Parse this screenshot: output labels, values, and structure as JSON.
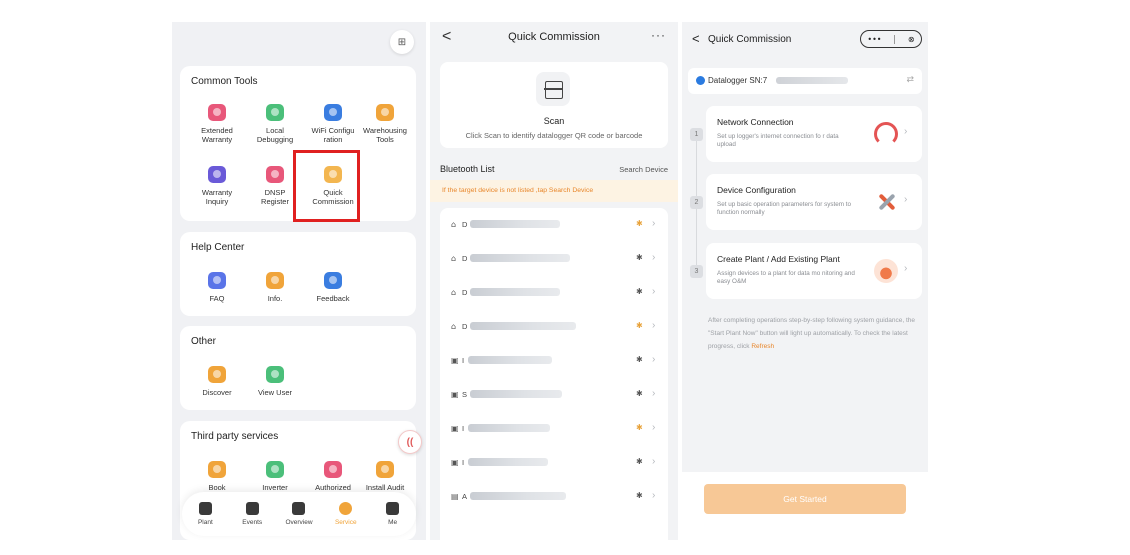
{
  "service": {
    "common_tools": {
      "title": "Common Tools",
      "items": [
        {
          "label": "Extended\nWarranty",
          "icon": "warranty-shield-icon",
          "color": "#e8577a"
        },
        {
          "label": "Local\nDebugging",
          "icon": "debug-chart-icon",
          "color": "#4bbf7a"
        },
        {
          "label": "WiFi Configu\nration",
          "icon": "wifi-cloud-icon",
          "color": "#3a7de0"
        },
        {
          "label": "Warehousing\nTools",
          "icon": "warehouse-box-icon",
          "color": "#f0a43a"
        },
        {
          "label": "Warranty\nInquiry",
          "icon": "warranty-inquiry-icon",
          "color": "#6a5ad8"
        },
        {
          "label": "DNSP\nRegister",
          "icon": "register-card-icon",
          "color": "#e8577a"
        },
        {
          "label": "Quick\nCommission",
          "icon": "quick-commission-icon",
          "color": "#f3b650"
        }
      ]
    },
    "help_center": {
      "title": "Help Center",
      "items": [
        {
          "label": "FAQ",
          "icon": "faq-icon",
          "color": "#5a74e8"
        },
        {
          "label": "Info.",
          "icon": "info-doc-icon",
          "color": "#f0a43a"
        },
        {
          "label": "Feedback",
          "icon": "feedback-chat-icon",
          "color": "#3a7de0"
        }
      ]
    },
    "other": {
      "title": "Other",
      "items": [
        {
          "label": "Discover",
          "icon": "discover-icon",
          "color": "#f0a43a"
        },
        {
          "label": "View User",
          "icon": "view-user-icon",
          "color": "#4bbf7a"
        }
      ]
    },
    "third_party": {
      "title": "Third party services",
      "items": [
        {
          "label": "Book",
          "icon": "book-icon",
          "color": "#f0a43a"
        },
        {
          "label": "Inverter",
          "icon": "inverter-icon",
          "color": "#4bbf7a"
        },
        {
          "label": "Authorized",
          "icon": "authorized-badge-icon",
          "color": "#e8577a"
        },
        {
          "label": "Install Audit",
          "icon": "install-audit-icon",
          "color": "#f0a43a"
        }
      ]
    },
    "tabs": [
      {
        "label": "Plant",
        "icon": "plant-home-icon"
      },
      {
        "label": "Events",
        "icon": "events-icon"
      },
      {
        "label": "Overview",
        "icon": "overview-grid-icon"
      },
      {
        "label": "Service",
        "icon": "service-icon",
        "active": true
      },
      {
        "label": "Me",
        "icon": "me-user-icon"
      }
    ]
  },
  "bluetooth": {
    "title": "Quick Commission",
    "back_glyph": "<",
    "more_glyph": "···",
    "scan_label": "Scan",
    "scan_desc": "Click Scan to identify datalogger QR code or barcode",
    "list_title": "Bluetooth List",
    "search_label": "Search Device",
    "tip": "If the target device is not listed ,tap Search Device",
    "devices": [
      {
        "icon": "bluetooth-device-icon",
        "prefix": "D",
        "signal": "strong"
      },
      {
        "icon": "bluetooth-device-icon",
        "prefix": "D",
        "signal": "medium"
      },
      {
        "icon": "bluetooth-device-icon",
        "prefix": "D",
        "signal": "medium"
      },
      {
        "icon": "bluetooth-device-icon",
        "prefix": "D",
        "signal": "strong"
      },
      {
        "icon": "bluetooth-device-icon",
        "prefix": "I",
        "signal": "medium"
      },
      {
        "icon": "bluetooth-device-icon",
        "prefix": "S",
        "signal": "medium"
      },
      {
        "icon": "bluetooth-device-icon",
        "prefix": "I",
        "signal": "strong"
      },
      {
        "icon": "bluetooth-device-icon",
        "prefix": "I",
        "signal": "medium"
      },
      {
        "icon": "bluetooth-device-icon",
        "prefix": "A",
        "signal": "medium"
      }
    ],
    "colors": {
      "tip_bg": "#fdf3e3",
      "tip_text": "#e8862a"
    }
  },
  "commission": {
    "title": "Quick Commission",
    "back_glyph": "<",
    "capsule": {
      "more": "•••",
      "close": "⊗"
    },
    "datalogger_label": "Datalogger SN:7",
    "steps": [
      {
        "num": "1",
        "title": "Network Connection",
        "desc": "Set up logger's internet connection fo r data upload",
        "icon": "network-router-icon"
      },
      {
        "num": "2",
        "title": "Device Configuration",
        "desc": "Set up basic operation parameters for system to function normally",
        "icon": "config-tools-icon"
      },
      {
        "num": "3",
        "title": "Create Plant / Add Existing Plant",
        "desc": "Assign devices to a plant for data mo nitoring and easy O&M",
        "icon": "plant-upload-icon"
      }
    ],
    "guide_text": "After completing operations step-by-step following system guidance, the \"Start Plant Now\" button will light up automatically.  To check the latest progress, click ",
    "refresh_label": "Refresh",
    "start_button": "Get Started",
    "colors": {
      "accent": "#e8862a",
      "button_disabled": "#f7c896"
    }
  }
}
